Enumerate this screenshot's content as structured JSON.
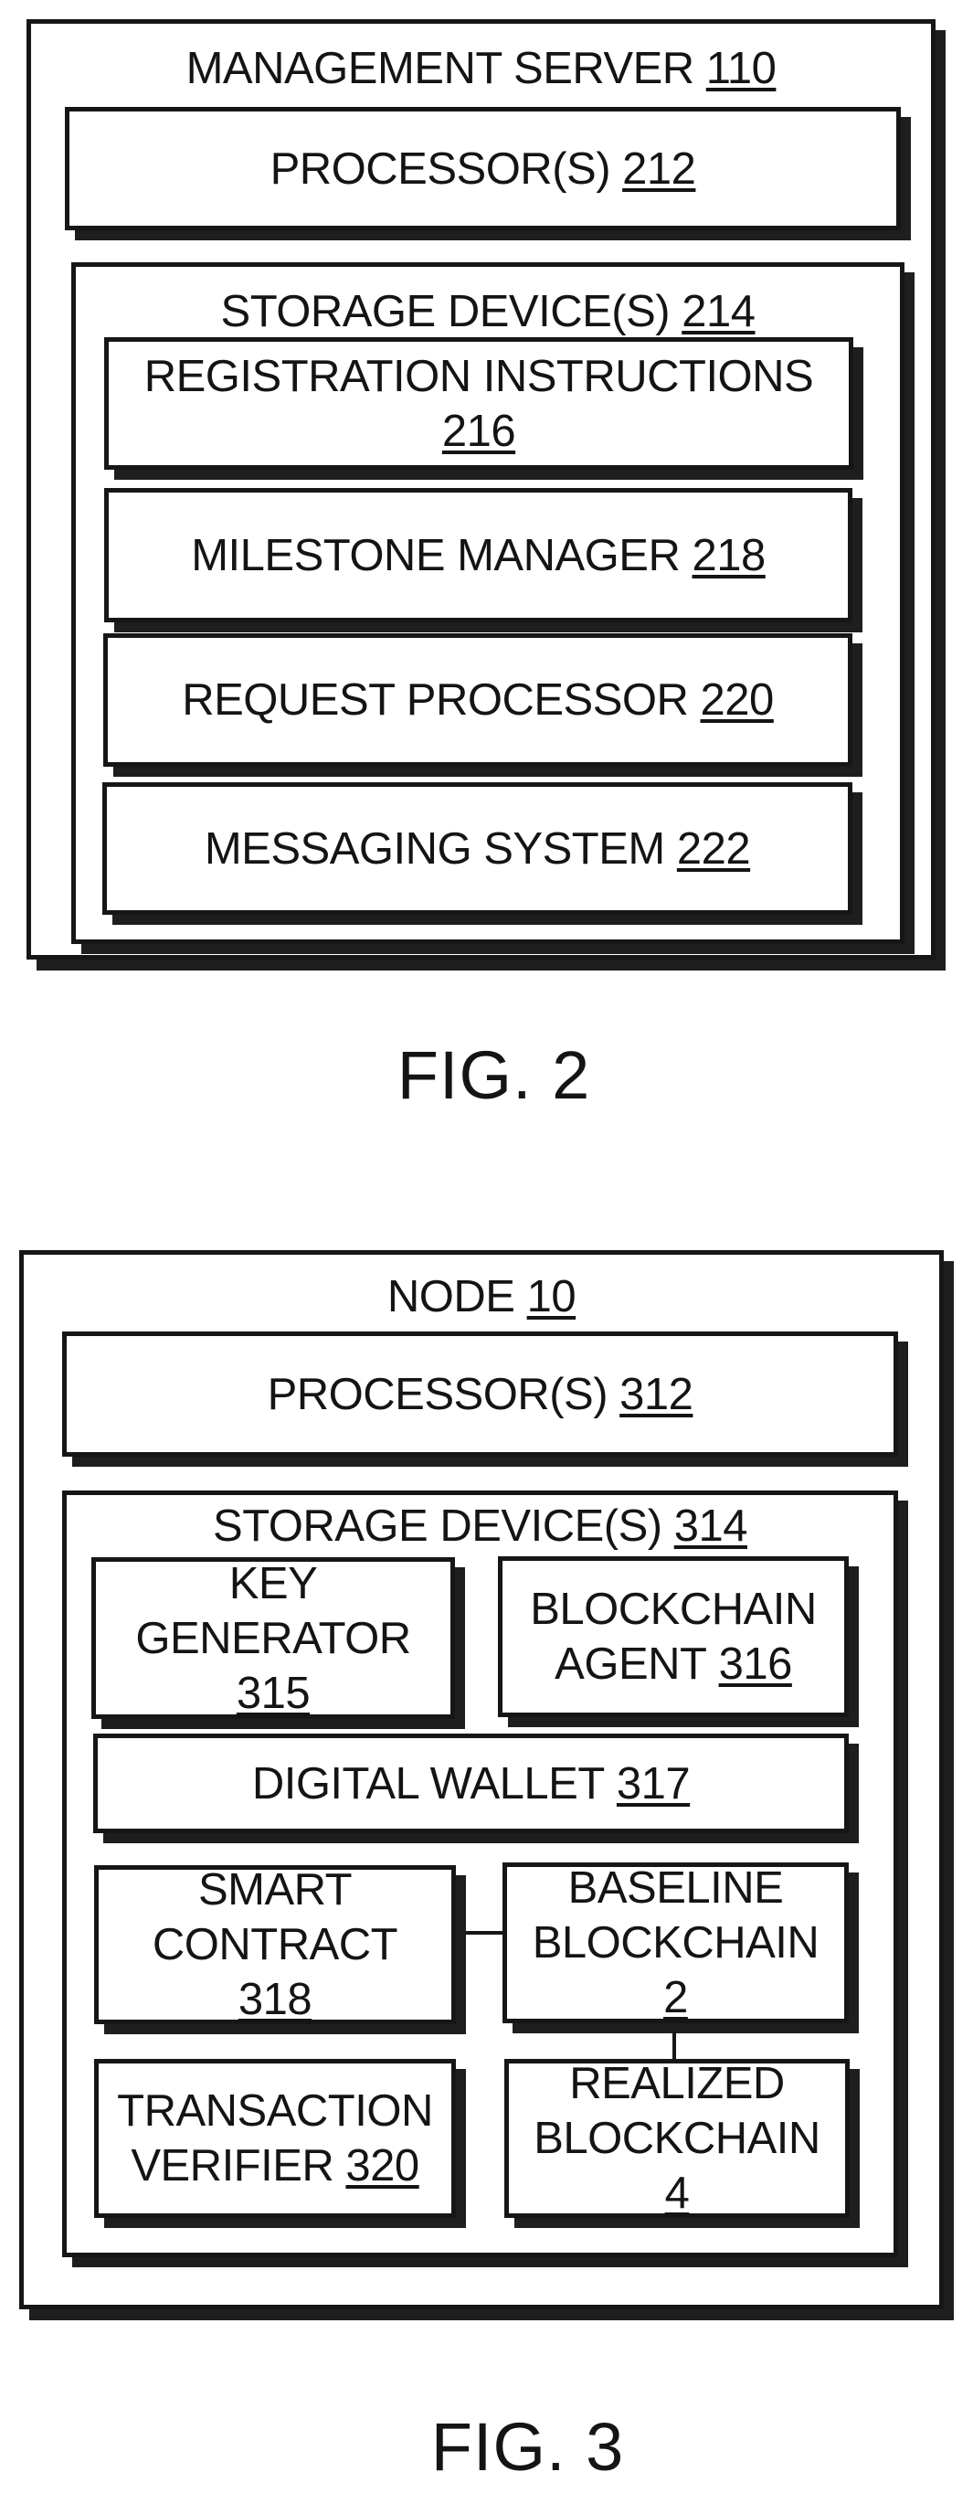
{
  "figures": [
    {
      "caption": "FIG. 2",
      "outer": {
        "text": "MANAGEMENT SERVER",
        "ref": "110"
      },
      "processor": {
        "text": "PROCESSOR(S)",
        "ref": "212"
      },
      "storage": {
        "text": "STORAGE DEVICE(S)",
        "ref": "214",
        "items": [
          {
            "lines": [
              "REGISTRATION INSTRUCTIONS"
            ],
            "ref": "216"
          },
          {
            "text": "MILESTONE MANAGER",
            "ref": "218"
          },
          {
            "text": "REQUEST PROCESSOR",
            "ref": "220"
          },
          {
            "text": "MESSAGING SYSTEM",
            "ref": "222"
          }
        ]
      }
    },
    {
      "caption": "FIG. 3",
      "outer": {
        "text": "NODE",
        "ref": "10"
      },
      "processor": {
        "text": "PROCESSOR(S)",
        "ref": "312"
      },
      "storage": {
        "text": "STORAGE DEVICE(S)",
        "ref": "314",
        "items": [
          {
            "line1": "KEY",
            "line2": "GENERATOR",
            "ref": "315"
          },
          {
            "line1": "BLOCKCHAIN",
            "line2": "AGENT",
            "ref": "316"
          },
          {
            "text": "DIGITAL WALLET",
            "ref": "317"
          },
          {
            "line1": "SMART",
            "line2": "CONTRACT",
            "ref": "318"
          },
          {
            "line1": "BASELINE",
            "line2": "BLOCKCHAIN",
            "ref": "2"
          },
          {
            "line1": "TRANSACTION",
            "line2": "VERIFIER",
            "ref": "320"
          },
          {
            "line1": "REALIZED",
            "line2": "BLOCKCHAIN",
            "ref": "4"
          }
        ]
      }
    }
  ]
}
